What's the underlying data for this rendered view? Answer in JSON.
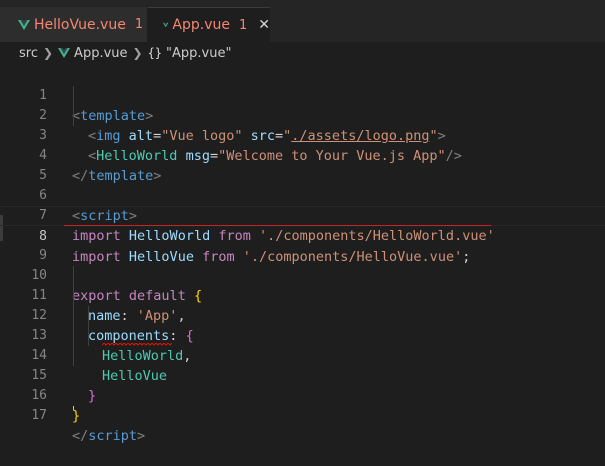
{
  "tabs": [
    {
      "name": "HelloVue.vue",
      "problems": "1"
    },
    {
      "name": "App.vue",
      "problems": "1",
      "close": "✕"
    }
  ],
  "breadcrumb": {
    "folder": "src",
    "file": "App.vue",
    "symbol_braces": "{}",
    "symbol": "\"App.vue\""
  },
  "editor": {
    "line_numbers": [
      "1",
      "2",
      "3",
      "4",
      "5",
      "6",
      "7",
      "8",
      "9",
      "10",
      "11",
      "12",
      "13",
      "14",
      "15",
      "16",
      "17"
    ],
    "active_line": "8",
    "lines": {
      "l1": {
        "open": "<",
        "tag": "template",
        "close": ">"
      },
      "l2": {
        "open": "<",
        "tag": "img",
        "attr1": "alt",
        "eq1": "=",
        "val1": "\"Vue logo\"",
        "attr2": "src",
        "eq2": "=",
        "q_open": "\"",
        "val2": "./assets/logo.png",
        "q_close": "\"",
        "close": ">"
      },
      "l3": {
        "open": "<",
        "tag": "HelloWorld",
        "attr": "msg",
        "eq": "=",
        "val": "\"Welcome to Your Vue.js App\"",
        "close": "/>"
      },
      "l4": {
        "open": "</",
        "tag": "template",
        "close": ">"
      },
      "l6": {
        "open": "<",
        "tag": "script",
        "close": ">"
      },
      "l7": {
        "kw1": "import",
        "name": "HelloWorld",
        "kw2": "from",
        "path": "'./components/HelloWorld.vue'"
      },
      "l8": {
        "kw1": "import",
        "name": "HelloVue",
        "kw2": "from",
        "path": "'./components/HelloVue.vue'",
        "semi": ";"
      },
      "l10": {
        "kw1": "export",
        "kw2": "default",
        "brace": "{"
      },
      "l11": {
        "key": "name",
        "colon": ":",
        "val": "'App'",
        "comma": ","
      },
      "l12": {
        "key": "components",
        "colon": ":",
        "brace": "{"
      },
      "l13": {
        "name": "HelloWorld",
        "comma": ","
      },
      "l14": {
        "name": "HelloVue"
      },
      "l15": {
        "brace": "}"
      },
      "l16": {
        "brace": "}"
      },
      "l17": {
        "open": "</",
        "tag": "script",
        "close": ">"
      }
    }
  },
  "colors": {
    "error": "#f48771",
    "squiggle": "#e51400",
    "background": "#1e1e1e"
  }
}
